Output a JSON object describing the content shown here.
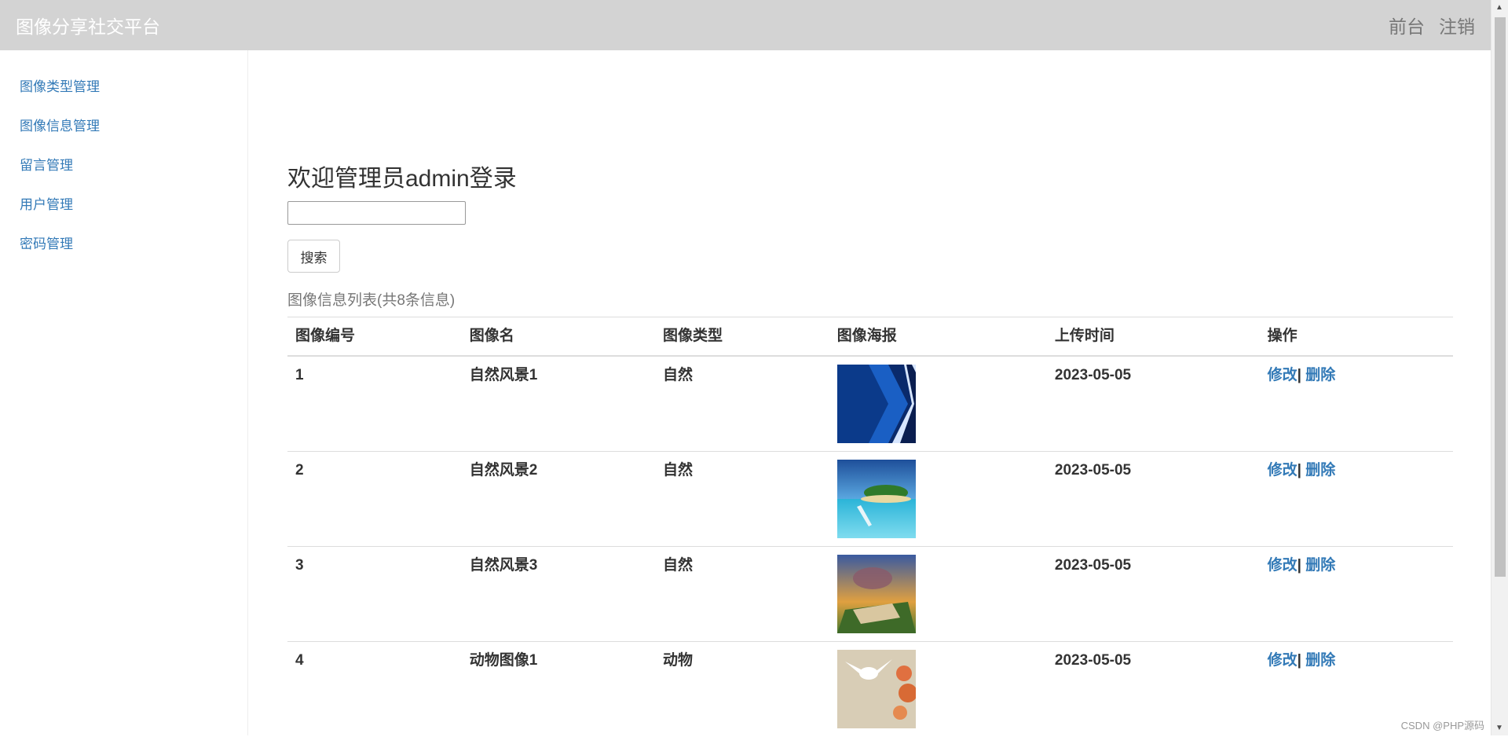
{
  "header": {
    "brand": "图像分享社交平台",
    "links": [
      "前台",
      "注销"
    ]
  },
  "sidebar": {
    "items": [
      "图像类型管理",
      "图像信息管理",
      "留言管理",
      "用户管理",
      "密码管理"
    ]
  },
  "main": {
    "welcome": "欢迎管理员admin登录",
    "search_value": "",
    "search_button": "搜索",
    "table_caption": "图像信息列表(共8条信息)",
    "columns": [
      "图像编号",
      "图像名",
      "图像类型",
      "图像海报",
      "上传时间",
      "操作"
    ],
    "rows": [
      {
        "id": "1",
        "name": "自然风景1",
        "type": "自然",
        "date": "2023-05-05",
        "edit": "修改",
        "sep": "|",
        "del": "删除"
      },
      {
        "id": "2",
        "name": "自然风景2",
        "type": "自然",
        "date": "2023-05-05",
        "edit": "修改",
        "sep": "|",
        "del": "删除"
      },
      {
        "id": "3",
        "name": "自然风景3",
        "type": "自然",
        "date": "2023-05-05",
        "edit": "修改",
        "sep": "|",
        "del": "删除"
      },
      {
        "id": "4",
        "name": "动物图像1",
        "type": "动物",
        "date": "2023-05-05",
        "edit": "修改",
        "sep": "|",
        "del": "删除"
      }
    ]
  },
  "watermark": "CSDN @PHP源码"
}
